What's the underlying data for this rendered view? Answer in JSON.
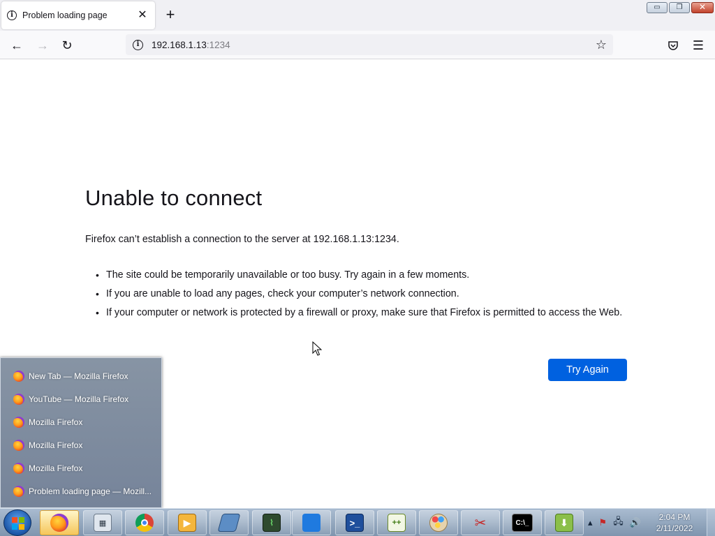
{
  "tab": {
    "title": "Problem loading page",
    "close_symbol": "✕",
    "icon": "info-icon"
  },
  "new_tab_symbol": "+",
  "window_controls": {
    "minimize": "▭",
    "restore": "❐",
    "close": "✕"
  },
  "navbar": {
    "back": "←",
    "forward": "→",
    "reload": "↻",
    "url_host": "192.168.1.13",
    "url_port": ":1234",
    "bookmark": "☆",
    "pocket": "pocket-icon",
    "menu": "☰"
  },
  "error_page": {
    "title": "Unable to connect",
    "description": "Firefox can’t establish a connection to the server at 192.168.1.13:1234.",
    "bullets": [
      "The site could be temporarily unavailable or too busy. Try again in a few moments.",
      "If you are unable to load any pages, check your computer’s network connection.",
      "If your computer or network is protected by a firewall or proxy, make sure that Firefox is permitted to access the Web."
    ],
    "button": "Try Again",
    "accent_color": "#0061e0"
  },
  "jump_list": {
    "items": [
      "New Tab — Mozilla Firefox",
      "YouTube — Mozilla Firefox",
      "Mozilla Firefox",
      "Mozilla Firefox",
      "Mozilla Firefox",
      "Problem loading page — Mozill..."
    ]
  },
  "taskbar": {
    "apps": [
      {
        "name": "firefox-icon",
        "active": true
      },
      {
        "name": "calculator-icon",
        "active": false
      },
      {
        "name": "chrome-icon",
        "active": false
      },
      {
        "name": "media-player-icon",
        "active": false
      },
      {
        "name": "storage-icon",
        "active": false
      },
      {
        "name": "task-manager-icon",
        "active": false
      },
      {
        "name": "windows-start-screen-icon",
        "active": false
      },
      {
        "name": "powershell-icon",
        "active": false
      },
      {
        "name": "notepad-plus-plus-icon",
        "active": false
      },
      {
        "name": "paint-icon",
        "active": false
      },
      {
        "name": "snipping-tool-icon",
        "active": false
      },
      {
        "name": "command-prompt-icon",
        "active": false
      },
      {
        "name": "installer-icon",
        "active": false
      }
    ],
    "clock_time": "2:04 PM",
    "clock_date": "2/11/2022"
  }
}
